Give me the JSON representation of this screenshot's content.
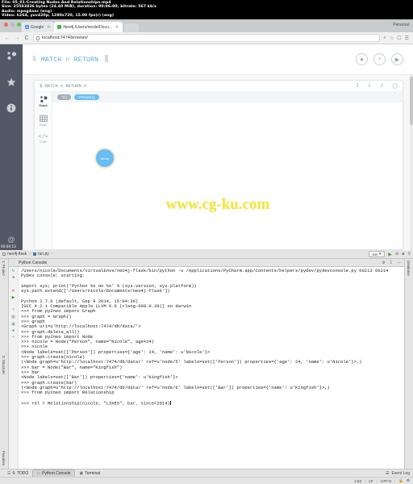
{
  "video_info": {
    "lines": [
      "File: 05_01-Creating Nodes And Relationships.mp4",
      "Size: 25583836 bytes (24.40 MiB), duration: 00:06:00, bitrate: 567 kb/s",
      "Audio: mpeg4aac (eng)",
      "Video: h264, yuv420p, 1280x720, 15.00 fps(r) (eng)"
    ],
    "timestamp": "00:04:13"
  },
  "browser": {
    "tabs": [
      {
        "title": "Google",
        "favicon": "google-icon",
        "active": false
      },
      {
        "title": "Neo4j  /Users/nicole/Docu...",
        "favicon": "neo4j-icon",
        "active": true
      }
    ],
    "profile_label": "Personal",
    "url": "localhost:7474/browser/",
    "nav": {
      "back": "←",
      "forward": "→",
      "reload": "C"
    },
    "omni_icons": [
      "zoom-icon",
      "star-icon",
      "cast-icon",
      "menu-icon"
    ]
  },
  "neo4j": {
    "rail_icons": [
      "graph-icon",
      "favorites-star-icon",
      "info-icon",
      "documents-icon"
    ],
    "editor": {
      "prompt": "$",
      "query_keyword_1": "MATCH",
      "query_var": "n",
      "query_keyword_2": "RETURN"
    },
    "editor_actions": [
      "favorite-star-icon",
      "add-icon",
      "run-play-icon"
    ],
    "card": {
      "query": "$ MATCH n RETURN n",
      "icons": [
        "download-icon",
        "pin-icon",
        "expand-icon",
        "close-icon"
      ],
      "views": [
        {
          "label": "Graph",
          "icon": "graph-view-icon",
          "active": true
        },
        {
          "label": "Rows",
          "icon": "table-view-icon",
          "active": false
        },
        {
          "label": "Code",
          "icon": "code-view-icon",
          "active": false
        }
      ],
      "legend": [
        {
          "label": "*(1)",
          "color": "#a5abb6"
        },
        {
          "label": "Person(1)",
          "color": "#68bdf6"
        }
      ],
      "nodes": [
        {
          "label": "Nicole",
          "color": "#68bdf6"
        }
      ]
    }
  },
  "watermark": "www.cg-ku.com",
  "ide": {
    "breadcrumbs": [
      {
        "label": "neo4j-flask",
        "icon": "folder-icon"
      },
      {
        "label": "run.py",
        "icon": "python-file-icon"
      }
    ],
    "run_config": "run",
    "toolbar_icons": [
      "run-icon",
      "debug-icon",
      "stop-icon",
      "search-icon"
    ],
    "left_tabs": [
      "1: Project",
      "2: Structure",
      "Favorites"
    ],
    "right_tabs": [
      "Database"
    ],
    "console_title": "Python Console",
    "console_lines": [
      {
        "gutter": "",
        "text": "/Users/nicole/Documents/VirtualEnvs/neo4j-flask/bin/python -u /Applications/PyCharm.app/Contents/helpers/pydev/pydevconsole.py 60213 60214"
      },
      {
        "gutter": "",
        "text": "PyDev console: starting."
      },
      {
        "gutter": "",
        "text": ""
      },
      {
        "gutter": "",
        "text": "import sys; print('Python %s on %s' % (sys.version, sys.platform))"
      },
      {
        "gutter": "",
        "text": "sys.path.extend(['/Users/nicole/Documents/neo4j-flask'])"
      },
      {
        "gutter": "",
        "text": ""
      },
      {
        "gutter": "",
        "text": "Python 2.7.6 (default, Sep  9 2014, 15:04:36)"
      },
      {
        "gutter": "",
        "text": "[GCC 4.2.1 Compatible Apple LLVM 6.0 (clang-600.0.39)] on darwin"
      },
      {
        "gutter": "",
        "text": ">>> from py2neo import Graph"
      },
      {
        "gutter": "",
        "text": ">>> graph = Graph()"
      },
      {
        "gutter": "",
        "text": ">>> graph"
      },
      {
        "gutter": "",
        "text": "<Graph uri=u'http://localhost:7474/db/data/'>"
      },
      {
        "gutter": "",
        "text": ">>> graph.delete_all()"
      },
      {
        "gutter": "",
        "text": ">>> from py2neo import Node"
      },
      {
        "gutter": "",
        "text": ">>> nicole = Node(\"Person\", name=\"Nicole\", age=24)"
      },
      {
        "gutter": "",
        "text": ">>> nicole"
      },
      {
        "gutter": "",
        "text": "<Node labels=set(['Person']) properties={'age': 24, 'name': u'Nicole'}>"
      },
      {
        "gutter": "",
        "text": ">>> graph.create(nicole)"
      },
      {
        "gutter": "",
        "text": "(<Node graph=u'http://localhost:7474/db/data/' ref=u'node/5' labels=set(['Person']) properties={'age': 24, 'name': u'Nicole'}>,)"
      },
      {
        "gutter": "",
        "text": ">>> bar = Node(\"Bar\", name=\"Kingfish\")"
      },
      {
        "gutter": "",
        "text": ">>> bar"
      },
      {
        "gutter": "",
        "text": "<Node labels=set(['Bar']) properties={'name': u'Kingfish'}>"
      },
      {
        "gutter": "",
        "text": ">>> graph.create(bar)"
      },
      {
        "gutter": "",
        "text": "(<Node graph=u'http://localhost:7474/db/data/' ref=u'node/6' labels=set(['Bar']) properties={'name': u'Kingfish'}>,)"
      },
      {
        "gutter": "",
        "text": ">>> from py2neo import Relationship"
      },
      {
        "gutter": "",
        "text": ""
      },
      {
        "gutter": "",
        "text": ">>> rel = Relationship(nicole, \"LIKES\", bar, since=2014)"
      }
    ],
    "bottom_tabs": [
      {
        "label": "6: TODO",
        "active": false
      },
      {
        "label": "Python Console",
        "active": true
      },
      {
        "label": "Terminal",
        "active": false
      }
    ],
    "event_log": "Event Log",
    "status": {
      "position": "1:52",
      "line_sep": "LF",
      "encoding": "UTF-8"
    }
  }
}
